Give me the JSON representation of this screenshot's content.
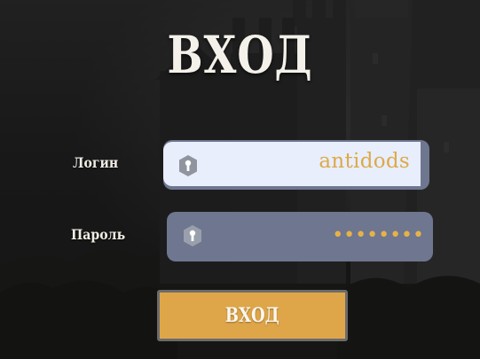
{
  "title": "ВХОД",
  "login": {
    "label": "Логин",
    "value": "antidods",
    "icon": "key-icon"
  },
  "password": {
    "label": "Пароль",
    "value": "••••••••",
    "icon": "key-icon"
  },
  "submit": {
    "label": "ВХОД"
  },
  "colors": {
    "accent": "#dfa649",
    "field": "#6e7690",
    "field_active": "#e8eefb",
    "text_light": "#f4f1ea"
  }
}
